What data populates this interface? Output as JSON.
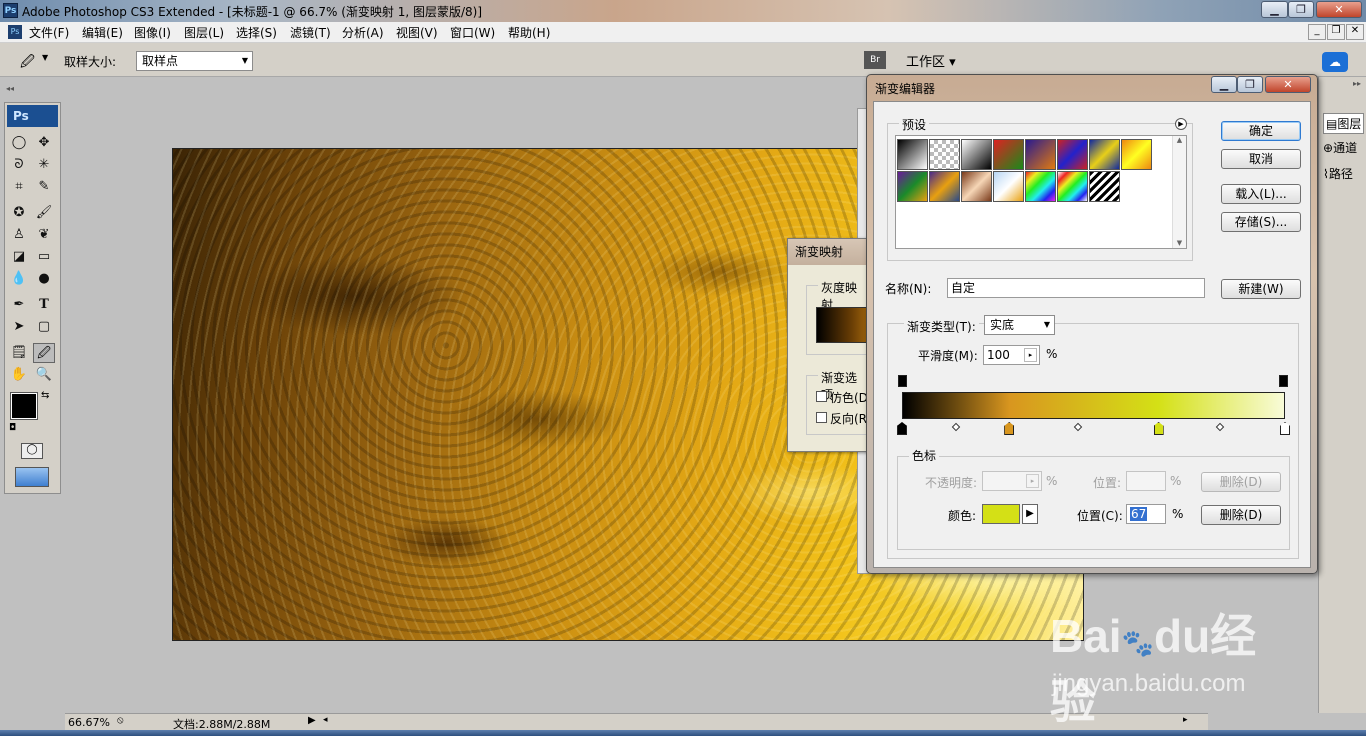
{
  "titlebar": {
    "title": "Adobe Photoshop CS3 Extended - [未标题-1 @ 66.7% (渐变映射 1, 图层蒙版/8)]",
    "ps": "Ps"
  },
  "menubar": {
    "items": [
      "文件(F)",
      "编辑(E)",
      "图像(I)",
      "图层(L)",
      "选择(S)",
      "滤镜(T)",
      "分析(A)",
      "视图(V)",
      "窗口(W)",
      "帮助(H)"
    ]
  },
  "options": {
    "sample_label": "取样大小:",
    "sample_value": "取样点",
    "workspace": "工作区"
  },
  "toolbox": {
    "header": "Ps"
  },
  "status": {
    "zoom": "66.67%",
    "doc": "文档:2.88M/2.88M"
  },
  "panels": {
    "layers": "图层",
    "channels": "通道",
    "paths": "路径"
  },
  "gradient_map": {
    "title": "渐变映射",
    "gray_label": "灰度映射",
    "options_label": "渐变选项",
    "dither": "仿色(D",
    "reverse": "反向(R"
  },
  "gradient_editor": {
    "title": "渐变编辑器",
    "presets_label": "预设",
    "ok": "确定",
    "cancel": "取消",
    "load": "载入(L)...",
    "save": "存储(S)...",
    "name_label": "名称(N):",
    "name_value": "自定",
    "new": "新建(W)",
    "type_label": "渐变类型(T):",
    "type_value": "实底",
    "smooth_label": "平滑度(M):",
    "smooth_value": "100",
    "pct": "%",
    "stops_label": "色标",
    "opacity_label": "不透明度:",
    "position_label": "位置:",
    "delete": "删除(D)",
    "color_label": "颜色:",
    "position_c_label": "位置(C):",
    "position_c_value": "67",
    "color_value": "#d4e016",
    "color_stops_pct": [
      0,
      28,
      67,
      100
    ]
  },
  "watermark": {
    "brand": "Bai",
    "du": "du",
    "cn": "经验",
    "url": "jingyan.baidu.com"
  }
}
